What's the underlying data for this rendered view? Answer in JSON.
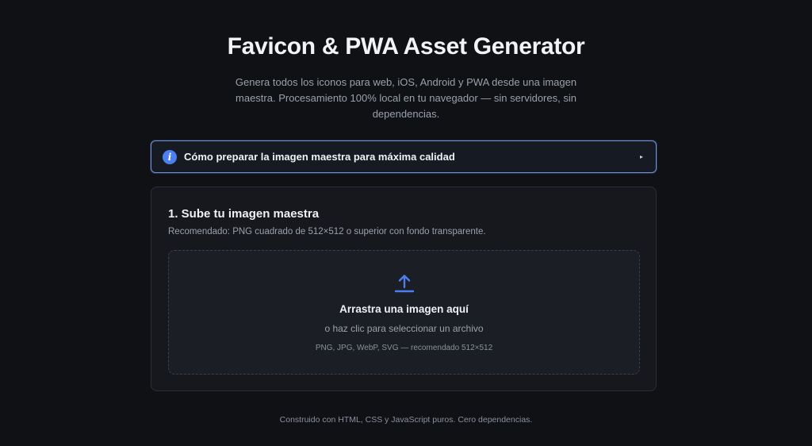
{
  "header": {
    "title": "Favicon & PWA Asset Generator",
    "subtitle": "Genera todos los iconos para web, iOS, Android y PWA desde una imagen maestra. Procesamiento 100% local en tu navegador — sin servidores, sin dependencias."
  },
  "info_panel": {
    "icon": "info-icon",
    "label": "Cómo preparar la imagen maestra para máxima calidad",
    "toggle_icon": "disclosure-triangle-icon",
    "toggle_glyph": "▸"
  },
  "upload_card": {
    "title": "1. Sube tu imagen maestra",
    "subtitle": "Recomendado: PNG cuadrado de 512×512 o superior con fondo transparente.",
    "dropzone": {
      "icon": "upload-icon",
      "main_text": "Arrastra una imagen aquí",
      "secondary_text": "o haz clic para seleccionar un archivo",
      "hint": "PNG, JPG, WebP, SVG — recomendado 512×512"
    }
  },
  "footer": {
    "text": "Construido con HTML, CSS y JavaScript puros. Cero dependencias."
  },
  "colors": {
    "background": "#0f1115",
    "accent": "#4d7ef0",
    "card": "#16181d",
    "dropzone": "#1b1e25"
  }
}
